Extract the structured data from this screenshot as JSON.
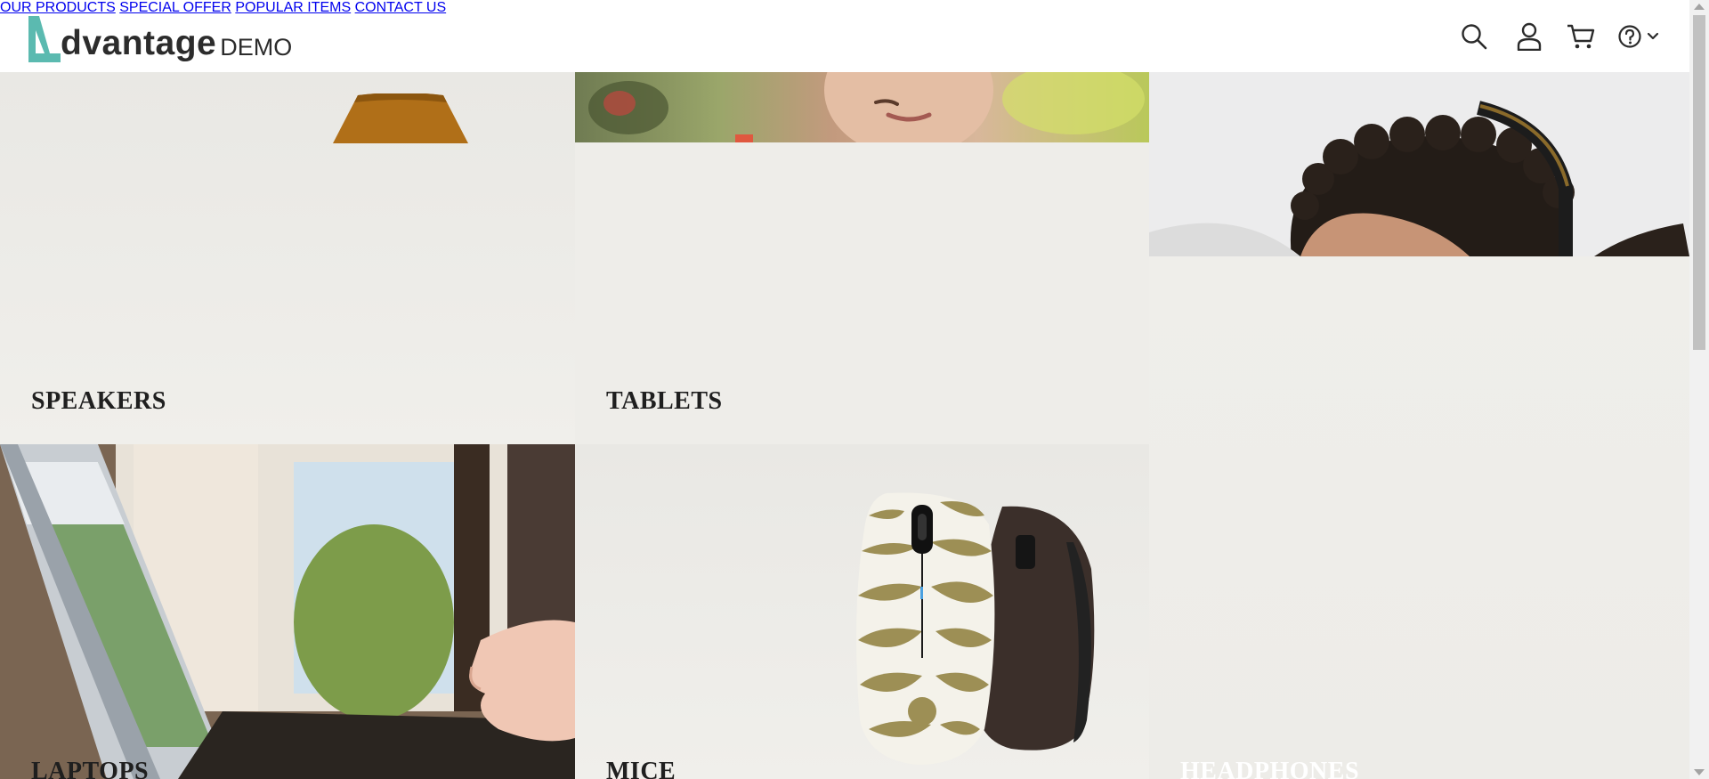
{
  "brand": {
    "name": "dvantage",
    "suffix": "DEMO",
    "accent": "#5bbab0"
  },
  "nav": {
    "items": [
      "OUR PRODUCTS",
      "SPECIAL OFFER",
      "POPULAR ITEMS",
      "CONTACT US"
    ]
  },
  "icons": [
    "search-icon",
    "user-icon",
    "cart-icon",
    "help-icon",
    "chevron-down-icon"
  ],
  "categories": {
    "speakers": "SPEAKERS",
    "tablets": "TABLETS",
    "laptops": "LAPTOPS",
    "mice": "MICE",
    "headphones": "HEADPHONES"
  },
  "colors": {
    "page_bg": "#efeeea",
    "header_bg": "#ffffff",
    "text": "#2b2b2b"
  }
}
